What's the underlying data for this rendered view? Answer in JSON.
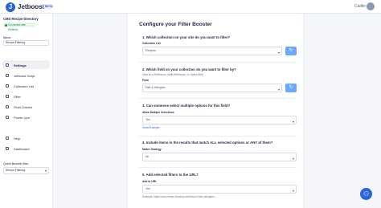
{
  "header": {
    "logo_glyph": "J",
    "brand": "Jetboost",
    "beta": "BETA",
    "user": "Caitlin"
  },
  "sidebar": {
    "site_title": "CMS Recipe Directory",
    "connected_badge": "Connected with Webflow",
    "name_label": "Name",
    "name_value": "Recipe Filtering",
    "items": [
      {
        "label": "Settings",
        "icon": "gear-icon",
        "active": true
      },
      {
        "label": "Jetboost Script",
        "icon": "code-icon",
        "active": false
      },
      {
        "label": "Collection List",
        "icon": "list-icon",
        "active": false
      },
      {
        "label": "Filter",
        "icon": "filter-icon",
        "active": false
      },
      {
        "label": "Final Checks",
        "icon": "check-icon",
        "active": false
      },
      {
        "label": "Power-Ups",
        "icon": "bolt-icon",
        "active": false
      }
    ],
    "bottom_items": [
      {
        "label": "Help",
        "icon": "help-icon"
      },
      {
        "label": "Dashboard",
        "icon": "dashboard-icon"
      }
    ],
    "quick_nav_label": "Quick Booster Nav",
    "quick_nav_value": "Recipe Filtering"
  },
  "main": {
    "title": "Configure your Filter Booster",
    "q1": "1. Which collection on your site do you want to filter?",
    "q1_field_label": "Collection List",
    "q1_value": "Recipes",
    "q2": "2. Which field on your collection do you want to filter by?",
    "q2_sub": "Must be a Reference, Multi-Reference, or Option field",
    "q2_field_label": "Field",
    "q2_value": "Diet & Allergies",
    "q3": "3. Can someone select multiple options for this field?",
    "q3_field_label": "Allow Multiple Selections",
    "q3_value": "Yes",
    "q3_link": "Show Example",
    "q4": "4. Include items in the results that match ALL selected options or ANY of them?",
    "q4_field_label": "Match Strategy",
    "q4_value": "All",
    "q5": "5. Add selected filters to the URL?",
    "q5_field_label": "Add to URL",
    "q5_value": "Yes",
    "q5_example": "Example: https://cms-recipe-directory.webflow.io/?diet-allergies=...",
    "refresh_glyph": "↻",
    "caret_glyph": "▾"
  },
  "help_glyph": "⚇"
}
